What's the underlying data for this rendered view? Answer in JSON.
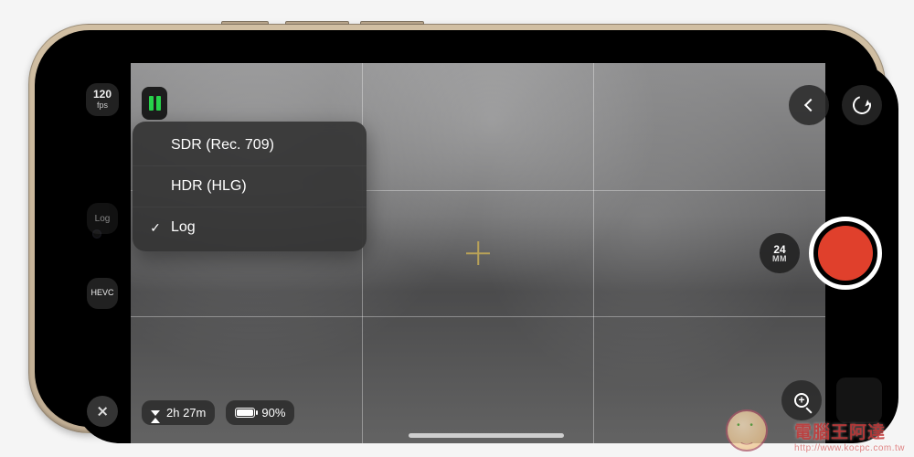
{
  "left_rail": {
    "fps": {
      "value": "120",
      "unit": "fps"
    },
    "format_label": "Log",
    "codec_label": "HEVC"
  },
  "format_menu": {
    "items": [
      {
        "label": "SDR (Rec. 709)",
        "selected": false
      },
      {
        "label": "HDR (HLG)",
        "selected": false
      },
      {
        "label": "Log",
        "selected": true
      }
    ]
  },
  "lens": {
    "focal": "24",
    "unit": "MM"
  },
  "bottom": {
    "remaining": "2h 27m",
    "battery": "90%"
  },
  "watermark": {
    "title": "電腦王阿達",
    "url": "http://www.kocpc.com.tw"
  }
}
